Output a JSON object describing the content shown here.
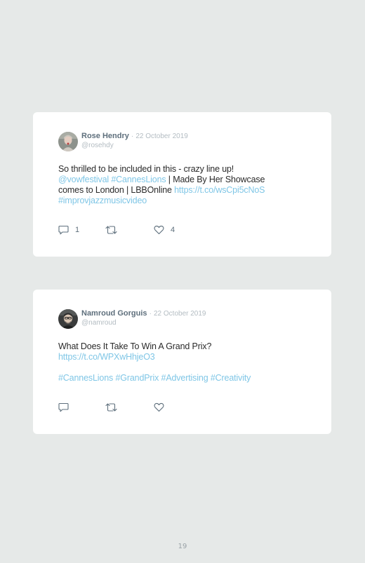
{
  "tweets": [
    {
      "author": "Rose Hendry",
      "separator": "·",
      "date": "22 October 2019",
      "handle": "@rosehdy",
      "body": {
        "line1": "So thrilled to be included in this - crazy line up!",
        "line2_link1": "@vowfestival",
        "line2_link2": "#CannesLions",
        "line2_text": " | Made By Her Showcase",
        "line3_text": "comes to London | LBBOnline ",
        "line3_link": "https://t.co/wsCpi5cNoS",
        "line4_link": "#improvjazzmusicvideo"
      },
      "actions": {
        "reply_count": "1",
        "like_count": "4"
      }
    },
    {
      "author": "Namroud Gorguis",
      "separator": "·",
      "date": "22 October 2019",
      "handle": "@namroud",
      "body": {
        "line1": "What Does It Take To Win A Grand Prix?",
        "line2_link": "https://t.co/WPXwHhjeO3",
        "hashtags": [
          "#CannesLions",
          "#GrandPrix",
          "#Advertising",
          "#Creativity"
        ]
      },
      "actions": {
        "reply_count": "",
        "like_count": ""
      }
    }
  ],
  "page_number": "19",
  "colors": {
    "background": "#e6e9e8",
    "card": "#ffffff",
    "link": "#7fc6e6",
    "author": "#5e6f7c",
    "muted": "#b3bcc2",
    "icon": "#5e6f7c"
  },
  "icons": {
    "reply": "reply-icon",
    "retweet": "retweet-icon",
    "like": "heart-icon"
  }
}
